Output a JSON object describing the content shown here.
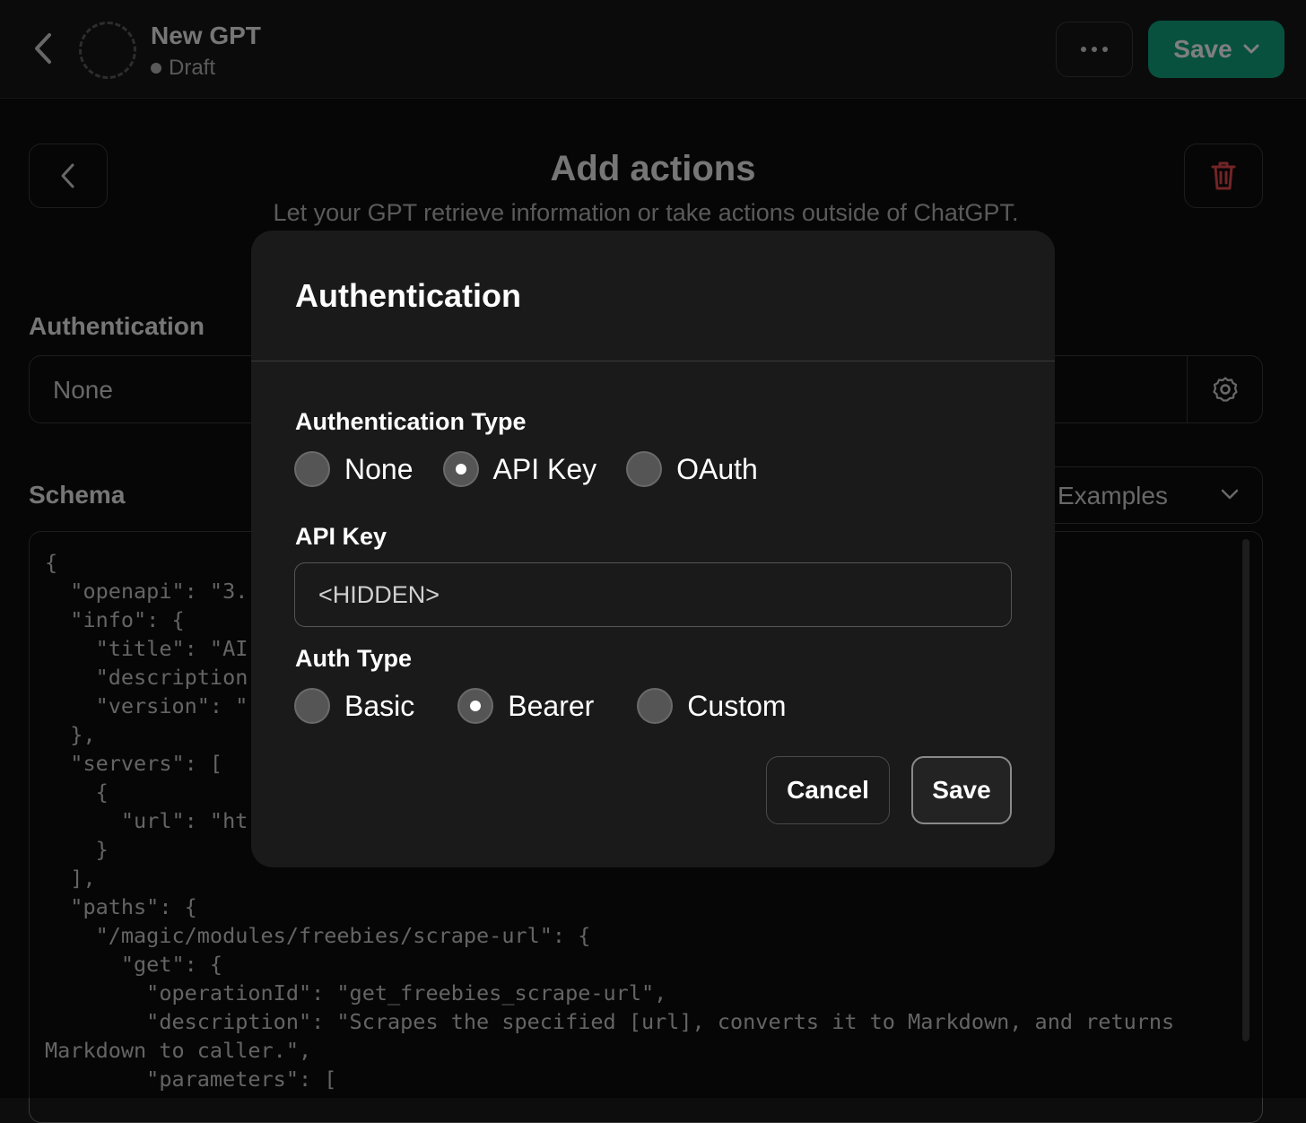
{
  "header": {
    "gpt_name": "New GPT",
    "gpt_status": "Draft",
    "save_label": "Save",
    "accent_color": "#10a37f"
  },
  "page": {
    "title": "Add actions",
    "subtitle": "Let your GPT retrieve information or take actions outside of ChatGPT.",
    "authentication_label": "Authentication",
    "authentication_value": "None",
    "schema_label": "Schema",
    "examples_label": "Examples",
    "schema_text": "{\n  \"openapi\": \"3.\n  \"info\": {\n    \"title\": \"AI\n    \"description\n    \"version\": \"\n  },\n  \"servers\": [\n    {\n      \"url\": \"ht\n    }\n  ],\n  \"paths\": {\n    \"/magic/modules/freebies/scrape-url\": {\n      \"get\": {\n        \"operationId\": \"get_freebies_scrape-url\",\n        \"description\": \"Scrapes the specified [url], converts it to Markdown, and returns\nMarkdown to caller.\",\n        \"parameters\": ["
  },
  "modal": {
    "title": "Authentication",
    "auth_type_label": "Authentication Type",
    "auth_type_options": [
      {
        "label": "None",
        "checked": false
      },
      {
        "label": "API Key",
        "checked": true
      },
      {
        "label": "OAuth",
        "checked": false
      }
    ],
    "api_key_label": "API Key",
    "api_key_value": "<HIDDEN>",
    "auth_subtype_label": "Auth Type",
    "auth_subtype_options": [
      {
        "label": "Basic",
        "checked": false
      },
      {
        "label": "Bearer",
        "checked": true
      },
      {
        "label": "Custom",
        "checked": false
      }
    ],
    "cancel_label": "Cancel",
    "save_label": "Save"
  }
}
